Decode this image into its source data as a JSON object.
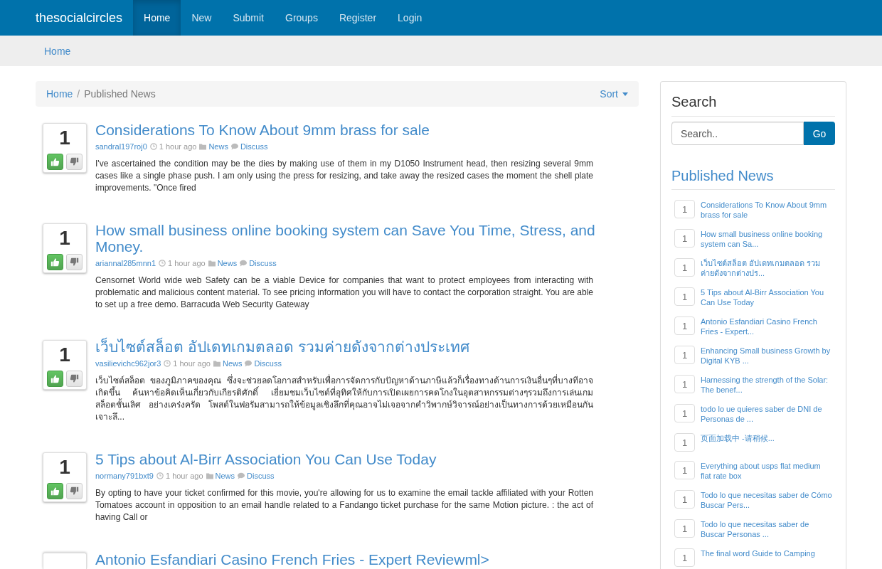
{
  "navbar": {
    "brand": "thesocialcircles",
    "items": [
      {
        "label": "Home",
        "selected": true
      },
      {
        "label": "New",
        "selected": false
      },
      {
        "label": "Submit",
        "selected": false
      },
      {
        "label": "Groups",
        "selected": false
      },
      {
        "label": "Register",
        "selected": false
      },
      {
        "label": "Login",
        "selected": false
      }
    ]
  },
  "subnav": {
    "link": "Home"
  },
  "breadcrumb": {
    "items": [
      "Home",
      "Published News"
    ],
    "separator": "/",
    "sort": "Sort"
  },
  "posts": [
    {
      "votes": "1",
      "title": "Considerations To Know About 9mm brass for sale",
      "author": "sandral197roj0",
      "time": "1 hour ago",
      "category": "News",
      "discuss": "Discuss",
      "excerpt": "I've ascertained the condition may be the dies by making use of them in my D1050 Instrument head, then resizing several 9mm cases like a single phase push. I am only using the press for resizing, and take away the resized cases the moment the shell plate improvements. \"Once fired"
    },
    {
      "votes": "1",
      "title": "How small business online booking system can Save You Time, Stress, and Money.",
      "author": "ariannal285mnn1",
      "time": "1 hour ago",
      "category": "News",
      "discuss": "Discuss",
      "excerpt": "Censornet World wide web Safety can be a viable Device for companies that want to protect employees from interacting with problematic and malicious content material. To see pricing information you will have to contact the corporation straight. You are able to set up a free demo. Barracuda Web Security Gateway"
    },
    {
      "votes": "1",
      "title": "เว็บไซต์สล็อต อัปเดทเกมตลอด รวมค่ายดังจากต่างประเทศ",
      "author": "vasilievichc962jor3",
      "time": "1 hour ago",
      "category": "News",
      "discuss": "Discuss",
      "excerpt": "เว็บไซต์สล็อต ของภูมิภาคของคุณ ซึ่งจะช่วยลดโอกาสสำหรับเพื่อการจัดการกับปัญหาด้านภาษีแล้วก็เรื่องทางด้านการเงินอื่นๆที่บางทีอาจเกิดขึ้น ค้นหาข้อคิดเห็นเกี่ยวกับเกียรติศักดิ์ เยี่ยมชมเว็บไซต์ที่อุทิศให้กับการเปิดเผยการคดโกงในอุตสาหกรรมต่างๆรวมถึงการเล่นเกมสล็อตชั้นเลิศ อย่างเคร่งครัด โพสต์ในฟอรัมสามารถให้ข้อมูลเชิงลึกที่คุณอาจไม่เจอจากคำวิพากษ์วิจารณ์อย่างเป็นทางการด้วยเหมือนกันเจาะลึ..."
    },
    {
      "votes": "1",
      "title": "5 Tips about Al-Birr Association You Can Use Today",
      "author": "normany791bxt9",
      "time": "1 hour ago",
      "category": "News",
      "discuss": "Discuss",
      "excerpt": "By opting to have your ticket confirmed for this movie, you're allowing for us to examine the email tackle affiliated with your Rotten Tomatoes account in opposition to an email handle related to a Fandango ticket purchase for the same Motion picture. : the act of having Call or"
    },
    {
      "title": "Antonio Esfandiari Casino French Fries - Expert Reviewml>"
    }
  ],
  "sidebar": {
    "search": {
      "heading": "Search",
      "placeholder": "Search..",
      "button": "Go"
    },
    "news": {
      "heading": "Published News",
      "items": [
        {
          "count": "1",
          "title": "Considerations To Know About 9mm brass for sale"
        },
        {
          "count": "1",
          "title": "How small business online booking system can Sa..."
        },
        {
          "count": "1",
          "title": "เว็บไซต์สล็อต อัปเดทเกมตลอด รวมค่ายดังจากต่างปร..."
        },
        {
          "count": "1",
          "title": "5 Tips about Al-Birr Association You Can Use Today"
        },
        {
          "count": "1",
          "title": "Antonio Esfandiari Casino French Fries - Expert..."
        },
        {
          "count": "1",
          "title": "Enhancing Small business Growth by Digital KYB ..."
        },
        {
          "count": "1",
          "title": "Harnessing the strength of the Solar: The benef..."
        },
        {
          "count": "1",
          "title": "todo lo ue quieres saber de DNI de Personas de ..."
        },
        {
          "count": "1",
          "title": "页面加载中 -请稍候..."
        },
        {
          "count": "1",
          "title": "Everything about usps flat medium flat rate box"
        },
        {
          "count": "1",
          "title": "Todo lo que necesitas saber de Cómo Buscar Pers..."
        },
        {
          "count": "1",
          "title": "Todo lo que necesitas saber de Buscar Personas ..."
        },
        {
          "count": "1",
          "title": "The final word Guide to Camping"
        }
      ]
    }
  }
}
